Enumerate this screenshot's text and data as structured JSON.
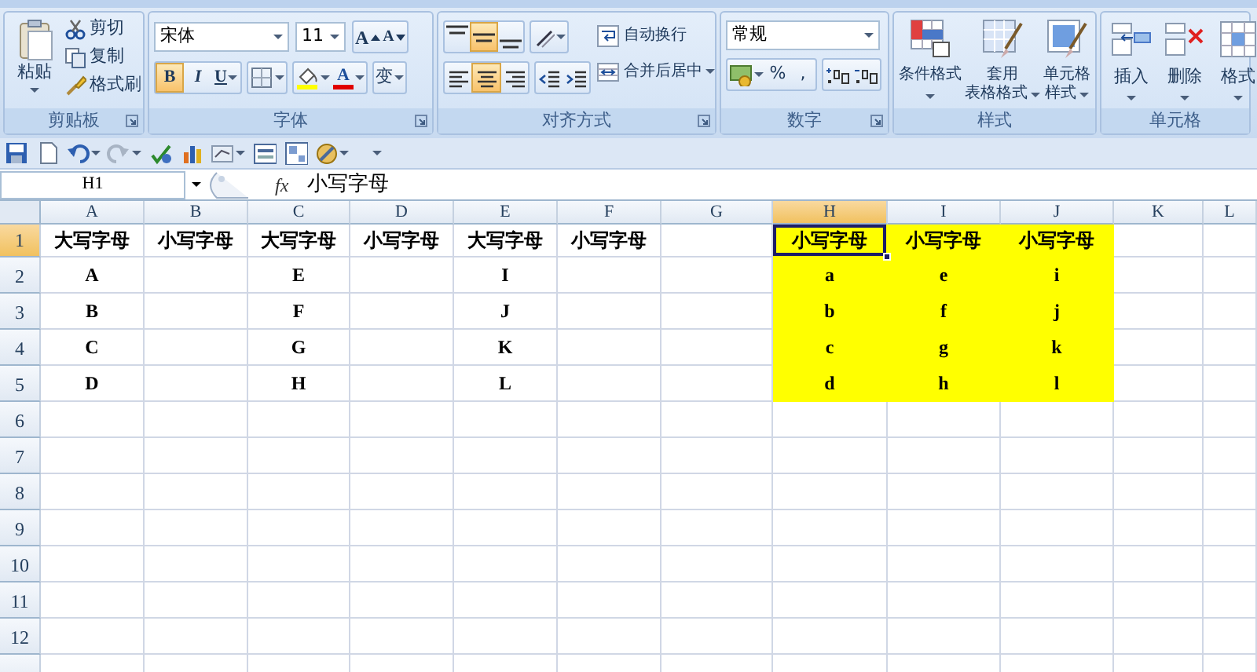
{
  "ribbon": {
    "groups": [
      {
        "kind": "clipboard",
        "label": "剪贴板",
        "paste": {
          "label": "粘贴"
        },
        "small_buttons": [
          {
            "label": "剪切"
          },
          {
            "label": "复制"
          },
          {
            "label": "格式刷"
          }
        ]
      },
      {
        "kind": "font",
        "label": "字体",
        "font_field": {
          "value": "宋体"
        },
        "size_field": {
          "value": "11"
        },
        "grow_button": {
          "label": "A"
        },
        "shrink_button": {
          "label": "A"
        },
        "style_buttons": [
          {
            "label": "B",
            "selected": true
          },
          {
            "label": "I",
            "selected": false
          },
          {
            "label": "U",
            "selected": false
          }
        ],
        "font_color_button": {
          "label": "A"
        },
        "phonetic_button": {
          "label": "变"
        }
      },
      {
        "kind": "alignment",
        "label": "对齐方式",
        "vertical_buttons": [
          {
            "selected": false
          },
          {
            "selected": true
          },
          {
            "selected": false
          }
        ],
        "horizontal_buttons": [
          {
            "selected": false
          },
          {
            "selected": true
          },
          {
            "selected": false
          }
        ],
        "wrap_button": {
          "label": "自动换行"
        },
        "merge_button": {
          "label": "合并后居中"
        }
      },
      {
        "kind": "number",
        "label": "数字",
        "format_field": {
          "value": "常规"
        },
        "percent_button": {
          "label": "%"
        },
        "comma_button": {
          "label": ","
        }
      },
      {
        "kind": "styles",
        "label": "样式",
        "buttons": [
          {
            "lines": [
              "条件格式"
            ]
          },
          {
            "lines": [
              "套用",
              "表格格式"
            ]
          },
          {
            "lines": [
              "单元格",
              "样式"
            ]
          }
        ]
      },
      {
        "kind": "cells",
        "label": "单元格",
        "buttons": [
          {
            "label": "插入"
          },
          {
            "label": "删除"
          },
          {
            "label": "格式"
          }
        ]
      }
    ]
  },
  "formula_bar": {
    "name_box": "H1",
    "function_label": "fx",
    "value": "小写字母"
  },
  "sheet": {
    "columns": [
      {
        "label": "A",
        "selected": false
      },
      {
        "label": "B",
        "selected": false
      },
      {
        "label": "C",
        "selected": false
      },
      {
        "label": "D",
        "selected": false
      },
      {
        "label": "E",
        "selected": false
      },
      {
        "label": "F",
        "selected": false
      },
      {
        "label": "G",
        "selected": false
      },
      {
        "label": "H",
        "selected": true
      },
      {
        "label": "I",
        "selected": false
      },
      {
        "label": "J",
        "selected": false
      },
      {
        "label": "K",
        "selected": false
      },
      {
        "label": "L",
        "selected": false
      }
    ],
    "rows": [
      {
        "number": "1",
        "selected": true,
        "cells": [
          {
            "text": "大写字母",
            "highlighted": false,
            "selected": false
          },
          {
            "text": "小写字母",
            "highlighted": false,
            "selected": false
          },
          {
            "text": "大写字母",
            "highlighted": false,
            "selected": false
          },
          {
            "text": "小写字母",
            "highlighted": false,
            "selected": false
          },
          {
            "text": "大写字母",
            "highlighted": false,
            "selected": false
          },
          {
            "text": "小写字母",
            "highlighted": false,
            "selected": false
          },
          {
            "highlighted": false,
            "selected": false
          },
          {
            "text": "小写字母",
            "highlighted": true,
            "selected": true
          },
          {
            "text": "小写字母",
            "highlighted": true,
            "selected": false
          },
          {
            "text": "小写字母",
            "highlighted": true,
            "selected": false
          }
        ]
      },
      {
        "number": "2",
        "selected": false,
        "cells": [
          {
            "text": "A",
            "highlighted": false,
            "selected": false
          },
          {
            "highlighted": false,
            "selected": false
          },
          {
            "text": "E",
            "highlighted": false,
            "selected": false
          },
          {
            "highlighted": false,
            "selected": false
          },
          {
            "text": "I",
            "highlighted": false,
            "selected": false
          },
          {
            "highlighted": false,
            "selected": false
          },
          {
            "highlighted": false,
            "selected": false
          },
          {
            "text": "a",
            "highlighted": true,
            "selected": false
          },
          {
            "text": "e",
            "highlighted": true,
            "selected": false
          },
          {
            "text": "i",
            "highlighted": true,
            "selected": false
          }
        ]
      },
      {
        "number": "3",
        "selected": false,
        "cells": [
          {
            "text": "B",
            "highlighted": false,
            "selected": false
          },
          {
            "highlighted": false,
            "selected": false
          },
          {
            "text": "F",
            "highlighted": false,
            "selected": false
          },
          {
            "highlighted": false,
            "selected": false
          },
          {
            "text": "J",
            "highlighted": false,
            "selected": false
          },
          {
            "highlighted": false,
            "selected": false
          },
          {
            "highlighted": false,
            "selected": false
          },
          {
            "text": "b",
            "highlighted": true,
            "selected": false
          },
          {
            "text": "f",
            "highlighted": true,
            "selected": false
          },
          {
            "text": "j",
            "highlighted": true,
            "selected": false
          }
        ]
      },
      {
        "number": "4",
        "selected": false,
        "cells": [
          {
            "text": "C",
            "highlighted": false,
            "selected": false
          },
          {
            "highlighted": false,
            "selected": false
          },
          {
            "text": "G",
            "highlighted": false,
            "selected": false
          },
          {
            "highlighted": false,
            "selected": false
          },
          {
            "text": "K",
            "highlighted": false,
            "selected": false
          },
          {
            "highlighted": false,
            "selected": false
          },
          {
            "highlighted": false,
            "selected": false
          },
          {
            "text": "c",
            "highlighted": true,
            "selected": false
          },
          {
            "text": "g",
            "highlighted": true,
            "selected": false
          },
          {
            "text": "k",
            "highlighted": true,
            "selected": false
          }
        ]
      },
      {
        "number": "5",
        "selected": false,
        "cells": [
          {
            "text": "D",
            "highlighted": false,
            "selected": false
          },
          {
            "highlighted": false,
            "selected": false
          },
          {
            "text": "H",
            "highlighted": false,
            "selected": false
          },
          {
            "highlighted": false,
            "selected": false
          },
          {
            "text": "L",
            "highlighted": false,
            "selected": false
          },
          {
            "highlighted": false,
            "selected": false
          },
          {
            "highlighted": false,
            "selected": false
          },
          {
            "text": "d",
            "highlighted": true,
            "selected": false
          },
          {
            "text": "h",
            "highlighted": true,
            "selected": false
          },
          {
            "text": "l",
            "highlighted": true,
            "selected": false
          }
        ]
      },
      {
        "number": "6",
        "selected": false
      },
      {
        "number": "7",
        "selected": false
      },
      {
        "number": "8",
        "selected": false
      },
      {
        "number": "9",
        "selected": false
      },
      {
        "number": "10",
        "selected": false
      },
      {
        "number": "11",
        "selected": false
      },
      {
        "number": "12",
        "selected": false
      }
    ]
  }
}
